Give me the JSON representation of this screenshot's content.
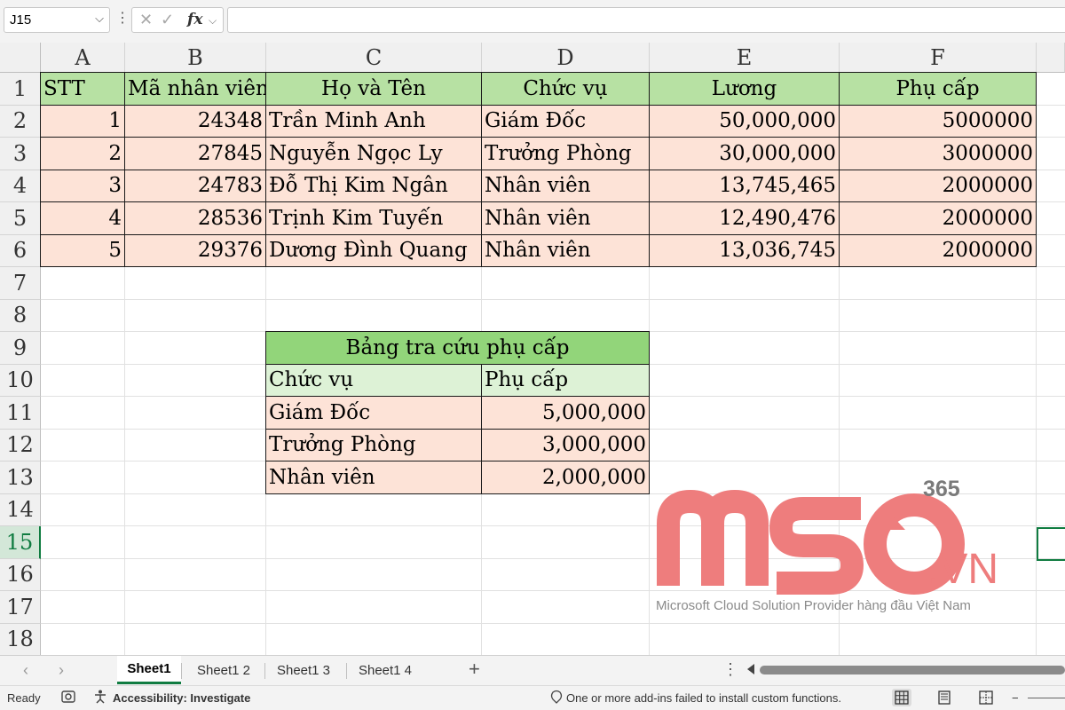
{
  "formula_bar": {
    "name_box": "J15",
    "dropdown_icon": "chevron-down-icon",
    "fx": "fx",
    "formula": ""
  },
  "columns": [
    "A",
    "B",
    "C",
    "D",
    "E",
    "F"
  ],
  "rows": [
    "1",
    "2",
    "3",
    "4",
    "5",
    "6",
    "7",
    "8",
    "9",
    "10",
    "11",
    "12",
    "13",
    "14",
    "15",
    "16",
    "17",
    "18"
  ],
  "active_row": "15",
  "main_table": {
    "headers": [
      "STT",
      "Mã nhân viên",
      "Họ và Tên",
      "Chức vụ",
      "Lương",
      "Phụ cấp"
    ],
    "rows": [
      [
        "1",
        "24348",
        "Trần Minh Anh",
        "Giám Đốc",
        "50,000,000",
        "5000000"
      ],
      [
        "2",
        "27845",
        "Nguyễn Ngọc Ly",
        "Trưởng Phòng",
        "30,000,000",
        "3000000"
      ],
      [
        "3",
        "24783",
        "Đỗ Thị Kim Ngân",
        "Nhân viên",
        "13,745,465",
        "2000000"
      ],
      [
        "4",
        "28536",
        "Trịnh Kim Tuyến",
        "Nhân viên",
        "12,490,476",
        "2000000"
      ],
      [
        "5",
        "29376",
        "Dương Đình Quang",
        "Nhân viên",
        "13,036,745",
        "2000000"
      ]
    ]
  },
  "lookup_table": {
    "title": "Bảng tra cứu phụ cấp",
    "headers": [
      "Chức vụ",
      "Phụ cấp"
    ],
    "rows": [
      [
        "Giám Đốc",
        "5,000,000"
      ],
      [
        "Trưởng Phòng",
        "3,000,000"
      ],
      [
        "Nhân viên",
        "2,000,000"
      ]
    ]
  },
  "watermark": {
    "brand": "MSO",
    "suffix": ".VN",
    "superscript": "365",
    "tagline": "Microsoft Cloud Solution Provider hàng đầu Việt Nam",
    "color": "#ee7d7d"
  },
  "tabs": {
    "items": [
      "Sheet1",
      "Sheet1 2",
      "Sheet1 3",
      "Sheet1 4"
    ],
    "active": "Sheet1",
    "add": "+",
    "more": "⋮"
  },
  "status": {
    "ready": "Ready",
    "accessibility": "Accessibility: Investigate",
    "message": "One or more add-ins failed to install custom functions."
  },
  "colors": {
    "accent": "#107c41",
    "header_fill": "#b7e1a3",
    "body_fill": "#fde3d7",
    "lookup_title_fill": "#92d57a",
    "lookup_header_fill": "#ddf2d6"
  }
}
